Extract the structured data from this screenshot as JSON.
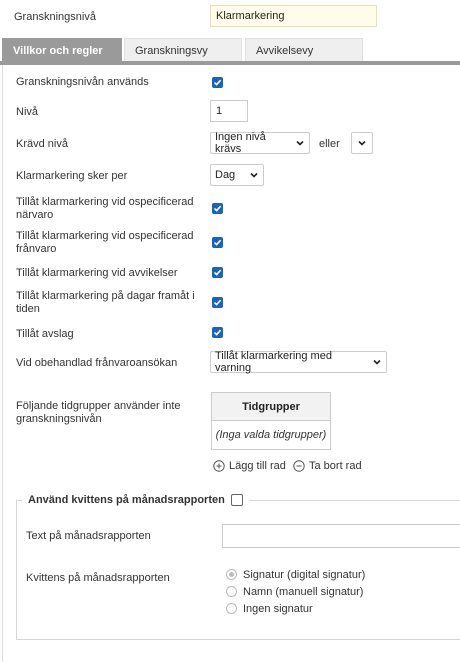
{
  "header": {
    "level_label": "Granskningsnivå",
    "level_value": "Klarmarkering"
  },
  "tabs": [
    {
      "label": "Villkor och regler",
      "active": true
    },
    {
      "label": "Granskningsvy",
      "active": false
    },
    {
      "label": "Avvikelsevy",
      "active": false
    }
  ],
  "form": {
    "used_label": "Granskningsnivån används",
    "used_checked": true,
    "level_label": "Nivå",
    "level_value": "1",
    "required_label": "Krävd nivå",
    "required_value": "Ingen nivå krävs",
    "or_label": "eller",
    "or_value": "",
    "per_label": "Klarmarkering sker per",
    "per_value": "Dag",
    "unspec_present_label": "Tillåt klarmarkering vid ospecificerad närvaro",
    "unspec_present_checked": true,
    "unspec_absent_label": "Tillåt klarmarkering vid ospecificerad frånvaro",
    "unspec_absent_checked": true,
    "deviations_label": "Tillåt klarmarkering vid avvikelser",
    "deviations_checked": true,
    "future_label": "Tillåt klarmarkering på dagar framåt i tiden",
    "future_checked": true,
    "reject_label": "Tillåt avslag",
    "reject_checked": true,
    "unhandled_label": "Vid obehandlad frånvaroansökan",
    "unhandled_value": "Tillåt klarmarkering med varning",
    "groups_label": "Följande tidgrupper använder inte granskningsnivån",
    "groups_header": "Tidgrupper",
    "groups_empty": "(Inga valda tidgrupper)",
    "add_row": "Lägg till rad",
    "remove_row": "Ta bort rad"
  },
  "receipt": {
    "title": "Använd kvittens på månadsrapporten",
    "checked": false,
    "text_label": "Text på månadsrapporten",
    "text_value": "",
    "receipt_label": "Kvittens på månadsrapporten",
    "options": [
      {
        "label": "Signatur (digital signatur)",
        "selected": true
      },
      {
        "label": "Namn (manuell signatur)",
        "selected": false
      },
      {
        "label": "Ingen signatur",
        "selected": false
      }
    ]
  },
  "colors": {
    "checkbox": "#1565c0",
    "active_tab": "#9a9a9a",
    "name_field_bg": "#fffde7"
  }
}
